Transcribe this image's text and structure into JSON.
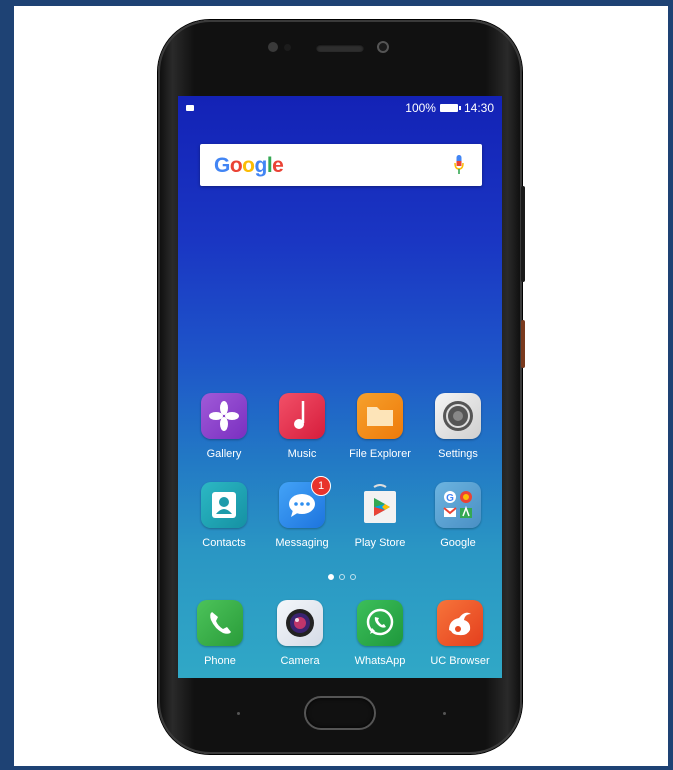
{
  "status_bar": {
    "battery_text": "100%",
    "time": "14:30"
  },
  "search_widget": {
    "logo_text": "Google",
    "mic_icon": "microphone-icon"
  },
  "apps_row1": [
    {
      "label": "Gallery",
      "icon": "gallery-icon",
      "color": "#8a3fc9"
    },
    {
      "label": "Music",
      "icon": "music-icon",
      "color": "#e8334d"
    },
    {
      "label": "File Explorer",
      "icon": "folder-icon",
      "color": "#f38a12"
    },
    {
      "label": "Settings",
      "icon": "settings-gear-icon",
      "color": "#e9e9e9"
    }
  ],
  "apps_row2": [
    {
      "label": "Contacts",
      "icon": "contact-person-icon",
      "color": "#1fa7b4"
    },
    {
      "label": "Messaging",
      "icon": "message-bubble-icon",
      "color": "#2f8ff0",
      "badge": "1"
    },
    {
      "label": "Play Store",
      "icon": "play-store-icon",
      "color": "#f4f4f4"
    },
    {
      "label": "Google",
      "icon": "google-folder-icon",
      "color": "#5fa3d4"
    }
  ],
  "page_indicator": {
    "pages": 3,
    "active": 0
  },
  "dock": [
    {
      "label": "Phone",
      "icon": "phone-handset-icon",
      "color": "#36b346"
    },
    {
      "label": "Camera",
      "icon": "camera-lens-icon",
      "color": "#e7ecf3"
    },
    {
      "label": "WhatsApp",
      "icon": "whatsapp-icon",
      "color": "#2aa849"
    },
    {
      "label": "UC Browser",
      "icon": "uc-browser-squirrel-icon",
      "color": "#f0552b"
    }
  ]
}
